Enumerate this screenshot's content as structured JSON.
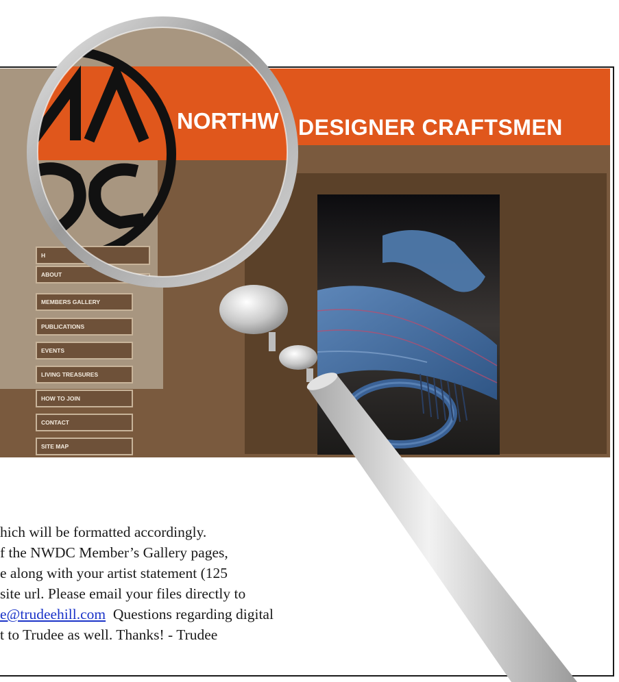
{
  "site": {
    "header_left": "NORTHW",
    "header_right": "DESIGNER CRAFTSMEN",
    "colors": {
      "header": "#e0571c",
      "sidebar": "#a89680",
      "page_bg": "#7a5a3e",
      "panel": "#5b4129",
      "link": "#1a33c8"
    },
    "nav_items": [
      {
        "label": "H"
      },
      {
        "label": "ABOUT"
      },
      {
        "label": "MEMBERS GALLERY"
      },
      {
        "label": "PUBLICATIONS"
      },
      {
        "label": "EVENTS"
      },
      {
        "label": "LIVING TREASURES"
      },
      {
        "label": "HOW TO JOIN"
      },
      {
        "label": "CONTACT"
      },
      {
        "label": "SITE MAP"
      }
    ],
    "photo_icon": "woven-scarf-photo",
    "logo_icon": "nwdc-logo-icon"
  },
  "body": {
    "line1": "hich will be formatted accordingly.",
    "line2": "f the NWDC Member’s Gallery pages,",
    "line3": "e along with your artist statement (125",
    "line4": "site url. Please email your files directly to",
    "line5_link": "e@trudeehill.com",
    "line5_rest": "  Questions regarding digital",
    "line6": "t to Trudee as well.  Thanks! - Trudee"
  },
  "magnifier_icon": "magnifying-glass-icon"
}
